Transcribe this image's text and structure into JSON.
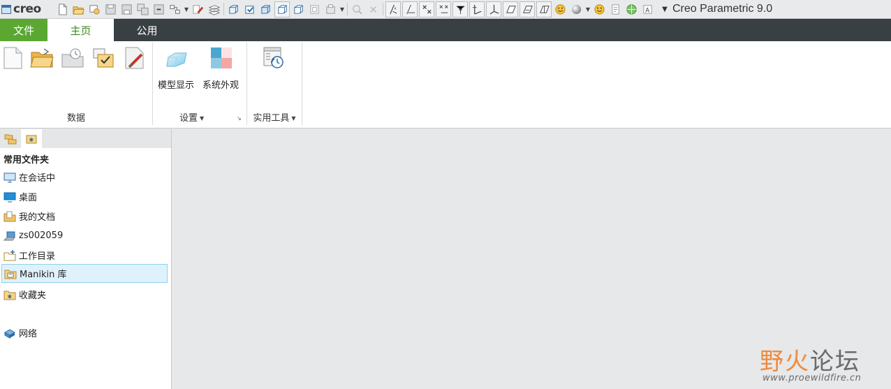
{
  "titlebar": {
    "brand": "creo",
    "app_title": "Creo Parametric 9.0",
    "quick_access_icons": [
      "new-icon",
      "open-icon",
      "open-from-session-icon",
      "save-icon",
      "save-as-icon",
      "save-copy-icon",
      "backup-icon",
      "regenerate-icon",
      "paint-icon",
      "layer-icon",
      "no-hidden-icon",
      "shaded-icon",
      "wireframe-icon",
      "shaded-edges-icon",
      "hidden-line-icon",
      "zoom-fit-icon",
      "view-manager-icon",
      "zoom-icon",
      "close-window-icon",
      "datum-plane-icon",
      "datum-axis-icon",
      "datum-point-icon",
      "datum-csys-icon",
      "sketch-icon",
      "annotation-icon",
      "spin-center-icon",
      "model-tree-icon",
      "plane-display-icon",
      "plane-tag-icon",
      "appearance-smile-icon",
      "sphere-icon",
      "smiley-icon",
      "notes-icon",
      "globe-icon",
      "text-style-icon"
    ]
  },
  "tabs": {
    "file": "文件",
    "home": "主页",
    "common": "公用"
  },
  "ribbon": {
    "data_group_label": "数据",
    "settings_group_label": "设置",
    "utilities_group_label": "实用工具",
    "model_display_label": "模型显示",
    "system_appearance_label": "系统外观",
    "dropdown_caret": "▼",
    "launcher_glyph": "↘"
  },
  "navigator": {
    "heading": "常用文件夹",
    "items": [
      {
        "label": "在会话中",
        "icon": "session-monitor-icon"
      },
      {
        "label": "桌面",
        "icon": "desktop-icon"
      },
      {
        "label": "我的文档",
        "icon": "documents-folder-icon"
      },
      {
        "label": "zs002059",
        "icon": "computer-icon"
      },
      {
        "label": "工作目录",
        "icon": "working-directory-icon"
      },
      {
        "label": "Manikin 库",
        "icon": "manikin-library-icon",
        "selected": true
      },
      {
        "label": "收藏夹",
        "icon": "favorites-icon"
      },
      {
        "label": "网络",
        "icon": "network-icon"
      }
    ]
  },
  "watermark": {
    "chars": [
      "野火",
      "论坛"
    ],
    "url": "www.proewildfire.cn",
    "accent_color": "#f08a3c"
  },
  "colors": {
    "file_tab": "#5aa832",
    "tab_bar": "#394043",
    "home_tab_text": "#3d8a1f",
    "selected_item_bg": "#dff2fc",
    "main_bg": "#e6e8ea"
  }
}
